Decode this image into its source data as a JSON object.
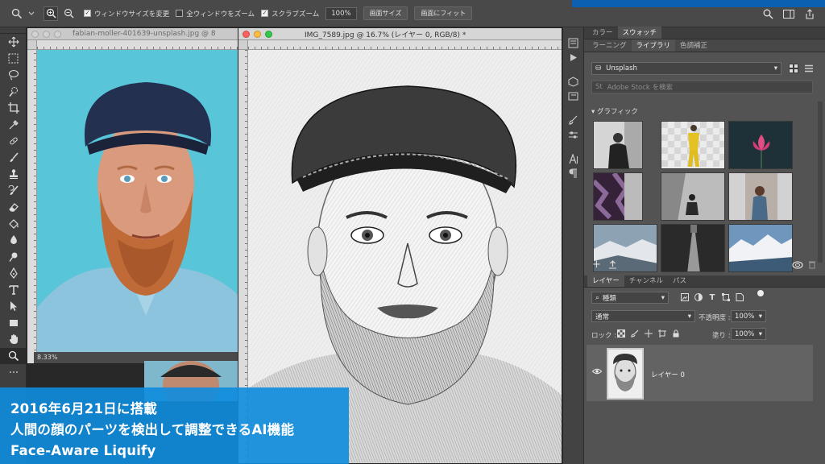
{
  "options_bar": {
    "resize_windows_label": "ウィンドウサイズを変更",
    "zoom_all_windows_label": "全ウィンドウをズーム",
    "scrubby_zoom_label": "スクラブズーム",
    "zoom_value": "100%",
    "fit_screen_button": "画面サイズ",
    "fill_screen_button": "画面にフィット"
  },
  "documents": {
    "back": {
      "title": "fabian-moller-401639-unsplash.jpg @ 8",
      "zoom_status": "8.33%"
    },
    "front": {
      "title": "IMG_7589.jpg @ 16.7% (レイヤー 0, RGB/8) *"
    }
  },
  "panels": {
    "top_tabs": [
      "カラー",
      "スウォッチ"
    ],
    "sub_tabs": [
      "ラーニング",
      "ライブラリ",
      "色調補正"
    ],
    "library_select": "Unsplash",
    "stock_search_placeholder": "Adobe Stock を検索",
    "graphics_header": "グラフィック",
    "layer_tabs": [
      "レイヤー",
      "チャンネル",
      "パス"
    ],
    "kind_filter": "種類",
    "blend_mode": "通常",
    "opacity_label": "不透明度 :",
    "opacity_value": "100%",
    "lock_label": "ロック :",
    "fill_label": "塗り :",
    "fill_value": "100%",
    "layer_name": "レイヤー 0"
  },
  "banner": {
    "line1": "2016年6月21日に搭載",
    "line2": "人間の顔のパーツを検出して調整できるAI機能",
    "line3": "Face-Aware Liquify"
  },
  "colors": {
    "accent": "#0b60b2",
    "banner": "#0e8cde",
    "cyan_background": "#58c5d8"
  }
}
